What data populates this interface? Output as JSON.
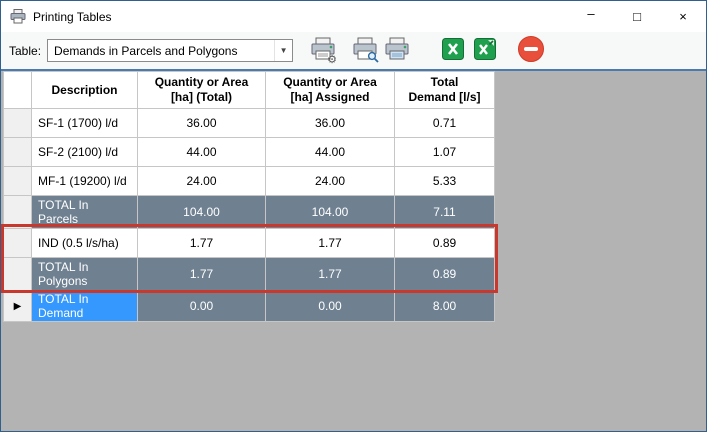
{
  "window": {
    "title": "Printing Tables",
    "controls": {
      "minimize": "–",
      "maximize": "□",
      "close": "×"
    }
  },
  "toolbar": {
    "table_label": "Table:",
    "dropdown_value": "Demands in Parcels and Polygons",
    "dropdown_chevron": "▼",
    "icons": [
      "print-setup",
      "print-preview",
      "print",
      "excel-view",
      "excel-export",
      "remove"
    ]
  },
  "table": {
    "current_row_marker": "▶",
    "headers": {
      "description": "Description",
      "qty_total": "Quantity or Area\n[ha] (Total)",
      "qty_assigned": "Quantity or Area\n[ha] Assigned",
      "total_demand": "Total\nDemand [l/s]"
    },
    "rows": [
      {
        "description": "SF-1 (1700) l/d",
        "qty_total": "36.00",
        "qty_assigned": "36.00",
        "demand": "0.71"
      },
      {
        "description": "SF-2 (2100) l/d",
        "qty_total": "44.00",
        "qty_assigned": "44.00",
        "demand": "1.07"
      },
      {
        "description": "MF-1 (19200) l/d",
        "qty_total": "24.00",
        "qty_assigned": "24.00",
        "demand": "5.33"
      },
      {
        "description": "TOTAL In\nParcels",
        "qty_total": "104.00",
        "qty_assigned": "104.00",
        "demand": "7.11"
      },
      {
        "description": "IND (0.5 l/s/ha)",
        "qty_total": "1.77",
        "qty_assigned": "1.77",
        "demand": "0.89"
      },
      {
        "description": "TOTAL In\nPolygons",
        "qty_total": "1.77",
        "qty_assigned": "1.77",
        "demand": "0.89"
      },
      {
        "description": "TOTAL In\nDemand",
        "qty_total": "0.00",
        "qty_assigned": "0.00",
        "demand": "8.00"
      }
    ]
  },
  "colors": {
    "total_row_bg": "#6f8191",
    "selected_cell_bg": "#3598fe",
    "annotation_red": "#c8382c",
    "excel_green": "#1fa04e",
    "remove_red": "#e8503c",
    "toolbar_separator_blue": "#4a7ab0"
  }
}
